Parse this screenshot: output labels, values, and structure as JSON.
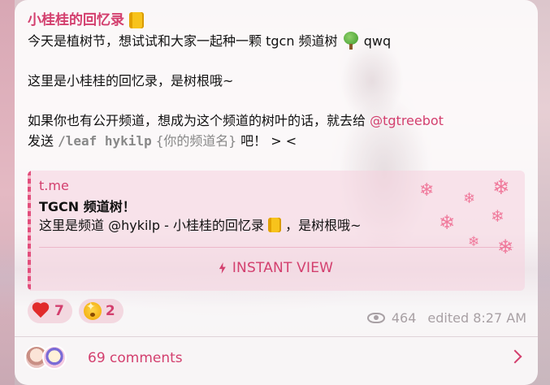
{
  "message": {
    "author": "小桂桂的回忆录",
    "lines": [
      {
        "before": "今天是植树节，想试试和大家一起种一颗 tgcn 频道树",
        "after": "qwq"
      },
      {
        "text": "这里是小桂桂的回忆录，是树根哦~"
      },
      {
        "text": "如果你也有公开频道，想成为这个频道的树叶的话，就去给",
        "mention": "@tgtreebot"
      },
      {
        "pre": "发送",
        "command": "/leaf hykilp",
        "param": "{你的频道名}",
        "post": "吧！ > <"
      }
    ]
  },
  "preview": {
    "site": "t.me",
    "title": "TGCN 频道树！",
    "desc_before": "这里是频道 @hykilp - 小桂桂的回忆录",
    "desc_after": "，是树根哦~",
    "instant_view": "INSTANT VIEW"
  },
  "reactions": [
    {
      "emoji": "heart-icon",
      "count": "7"
    },
    {
      "emoji": "star-struck-icon",
      "count": "2"
    }
  ],
  "meta": {
    "views": "464",
    "edited": "edited 8:27 AM"
  },
  "comments": {
    "label": "69 comments"
  },
  "colors": {
    "accent": "#d33f6e",
    "muted": "#a8a0a4"
  }
}
